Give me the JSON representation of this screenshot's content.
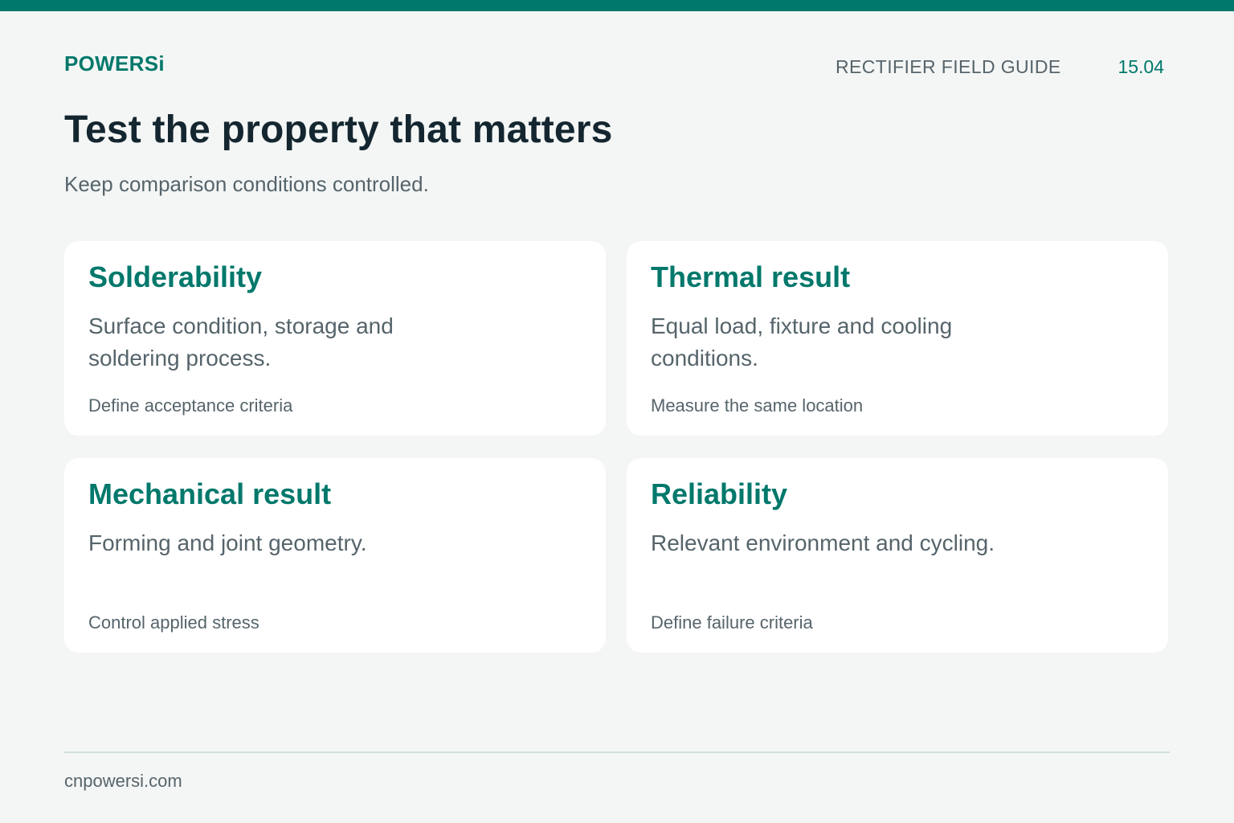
{
  "header": {
    "brand": "POWERSi",
    "guide_title": "RECTIFIER FIELD GUIDE",
    "page_number": "15.04"
  },
  "main": {
    "headline": "Test the property that matters",
    "subtitle": "Keep comparison conditions controlled.",
    "cards": [
      {
        "title": "Solderability",
        "description": "Surface condition, storage and soldering process.",
        "note": "Define acceptance criteria"
      },
      {
        "title": "Thermal result",
        "description": "Equal load, fixture and cooling conditions.",
        "note": "Measure the same location"
      },
      {
        "title": "Mechanical result",
        "description": "Forming and joint geometry.",
        "note": "Control applied stress"
      },
      {
        "title": "Reliability",
        "description": "Relevant environment and cycling.",
        "note": "Define failure criteria"
      }
    ]
  },
  "footer": {
    "website": "cnpowersi.com"
  },
  "colors": {
    "accent": "#00786b",
    "background": "#f4f6f5",
    "card": "#ffffff",
    "heading": "#14262f",
    "muted_text": "#56646b",
    "divider": "#cfe0da"
  }
}
